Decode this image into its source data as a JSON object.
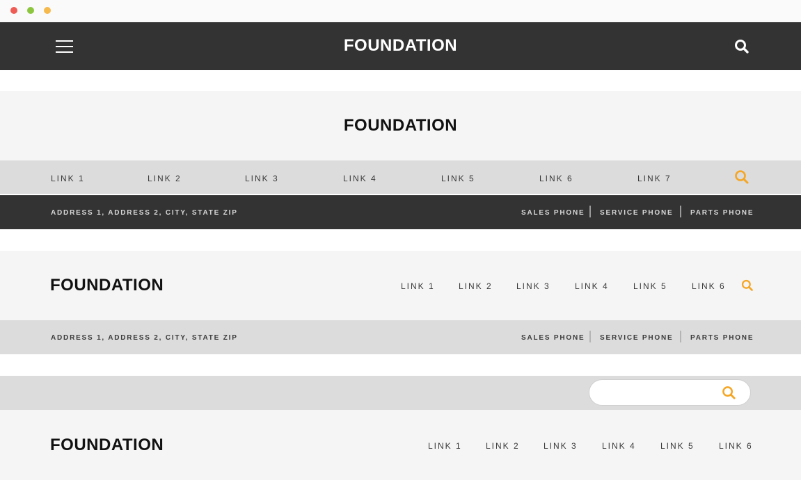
{
  "window": {
    "dots": [
      "#ee5c55",
      "#8cc63f",
      "#f5b94c"
    ]
  },
  "header1": {
    "brand": "FOUNDATION",
    "bg": "#333333"
  },
  "header2": {
    "brand": "FOUNDATION",
    "links": [
      "LINK 1",
      "LINK 2",
      "LINK 3",
      "LINK 4",
      "LINK 5",
      "LINK 6",
      "LINK 7"
    ],
    "address": "ADDRESS 1, ADDRESS 2, CITY, STATE ZIP",
    "phones": [
      "SALES PHONE",
      "SERVICE PHONE",
      "PARTS PHONE"
    ]
  },
  "header3": {
    "brand": "FOUNDATION",
    "links": [
      "LINK 1",
      "LINK 2",
      "LINK 3",
      "LINK 4",
      "LINK 5",
      "LINK 6"
    ],
    "address": "ADDRESS 1, ADDRESS 2, CITY, STATE ZIP",
    "phones": [
      "SALES PHONE",
      "SERVICE PHONE",
      "PARTS PHONE"
    ]
  },
  "header4": {
    "search_placeholder": "",
    "brand": "FOUNDATION",
    "links": [
      "LINK 1",
      "LINK 2",
      "LINK 3",
      "LINK 4",
      "LINK 5",
      "LINK 6"
    ]
  },
  "icons": {
    "menu": "hamburger-menu-icon",
    "search": "search-icon"
  },
  "colors": {
    "accent": "#f5a623",
    "dark": "#333333",
    "light": "#f5f5f5",
    "mid": "#dcdcdc"
  }
}
